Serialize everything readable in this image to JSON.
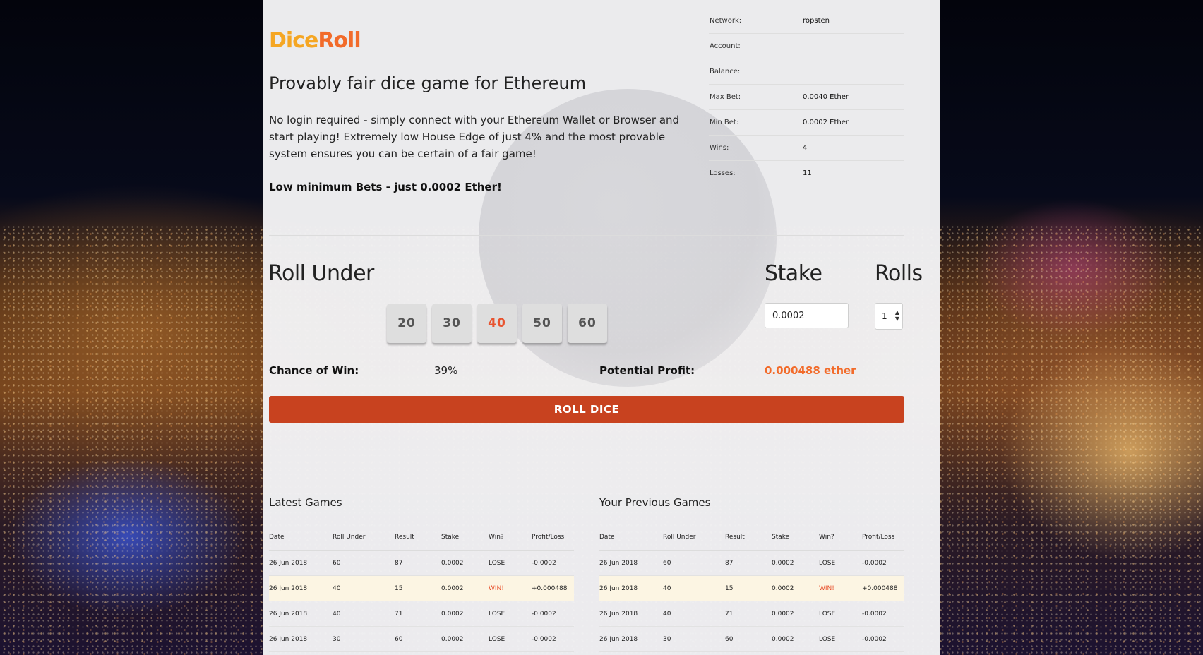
{
  "logo": {
    "part1": "Dice",
    "part2": "Roll"
  },
  "headline": "Provably fair dice game for Ethereum",
  "intro": "No login required - simply connect with your Ethereum Wallet or Browser and start playing! Extremely low House Edge of just 4% and the most provable system ensures you can be certain of a fair game!",
  "min_bet_note": "Low minimum Bets - just 0.0002 Ether!",
  "info": [
    {
      "label": "Network:",
      "value": "ropsten"
    },
    {
      "label": "Account:",
      "value": ""
    },
    {
      "label": "Balance:",
      "value": ""
    },
    {
      "label": "Max Bet:",
      "value": "0.0040 Ether"
    },
    {
      "label": "Min Bet:",
      "value": "0.0002 Ether"
    },
    {
      "label": "Wins:",
      "value": "4"
    },
    {
      "label": "Losses:",
      "value": "11"
    }
  ],
  "game": {
    "roll_under_label": "Roll Under",
    "options": [
      "20",
      "30",
      "40",
      "50",
      "60"
    ],
    "selected": "40",
    "stake_label": "Stake",
    "stake_value": "0.0002",
    "rolls_label": "Rolls",
    "rolls_value": "1",
    "chance_label": "Chance of Win:",
    "chance_value": "39%",
    "profit_label": "Potential Profit:",
    "profit_value": "0.000488 ether",
    "roll_button": "ROLL DICE"
  },
  "colors": {
    "accent": "#f26b2a",
    "logo_dice": "#f5a623",
    "roll_button": "#c8421f",
    "win": "#e8532f"
  },
  "latest_games": {
    "title": "Latest Games",
    "columns": [
      "Date",
      "Roll Under",
      "Result",
      "Stake",
      "Win?",
      "Profit/Loss"
    ],
    "rows": [
      [
        "26 Jun 2018",
        "60",
        "87",
        "0.0002",
        "LOSE",
        "-0.0002"
      ],
      [
        "26 Jun 2018",
        "40",
        "15",
        "0.0002",
        "WIN!",
        "+0.000488"
      ],
      [
        "26 Jun 2018",
        "40",
        "71",
        "0.0002",
        "LOSE",
        "-0.0002"
      ],
      [
        "26 Jun 2018",
        "30",
        "60",
        "0.0002",
        "LOSE",
        "-0.0002"
      ]
    ]
  },
  "previous_games": {
    "title": "Your Previous Games",
    "columns": [
      "Date",
      "Roll Under",
      "Result",
      "Stake",
      "Win?",
      "Profit/Loss"
    ],
    "rows": [
      [
        "26 Jun 2018",
        "60",
        "87",
        "0.0002",
        "LOSE",
        "-0.0002"
      ],
      [
        "26 Jun 2018",
        "40",
        "15",
        "0.0002",
        "WIN!",
        "+0.000488"
      ],
      [
        "26 Jun 2018",
        "40",
        "71",
        "0.0002",
        "LOSE",
        "-0.0002"
      ],
      [
        "26 Jun 2018",
        "30",
        "60",
        "0.0002",
        "LOSE",
        "-0.0002"
      ]
    ]
  }
}
